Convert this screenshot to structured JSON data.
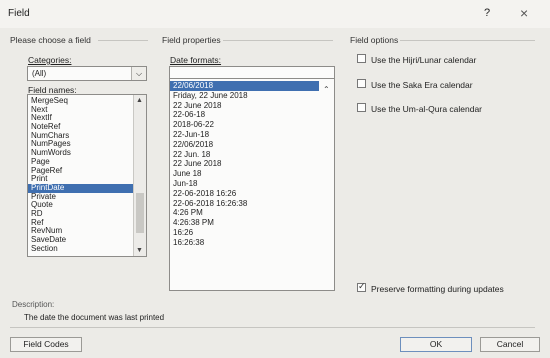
{
  "window": {
    "title": "Field",
    "help": "?",
    "close": "×"
  },
  "left": {
    "group": "Please choose a field",
    "categories_label": "Categories:",
    "categories_value": "(All)",
    "fieldnames_label": "Field names:",
    "fields": [
      "MergeSeq",
      "Next",
      "NextIf",
      "NoteRef",
      "NumChars",
      "NumPages",
      "NumWords",
      "Page",
      "PageRef",
      "Print",
      "PrintDate",
      "Private",
      "Quote",
      "RD",
      "Ref",
      "RevNum",
      "SaveDate",
      "Section"
    ],
    "selected_field": "PrintDate"
  },
  "middle": {
    "group": "Field properties",
    "formats_label": "Date formats:",
    "formats": [
      "22/06/2018",
      "Friday, 22 June 2018",
      "22 June 2018",
      "22-06-18",
      "2018-06-22",
      "22-Jun-18",
      "22/06/2018",
      "22 Jun. 18",
      "22 June 2018",
      "June 18",
      "Jun-18",
      "22-06-2018 16:26",
      "22-06-2018 16:26:38",
      "4:26 PM",
      "4:26:38 PM",
      "16:26",
      "16:26:38"
    ]
  },
  "right": {
    "group": "Field options",
    "options": [
      {
        "label": "Use the Hijri/Lunar calendar",
        "checked": false
      },
      {
        "label": "Use the Saka Era calendar",
        "checked": false
      },
      {
        "label": "Use the Um-al-Qura calendar",
        "checked": false
      }
    ],
    "preserve_label": "Preserve formatting during updates",
    "preserve_checked": true
  },
  "description": {
    "label": "Description:",
    "text": "The date the document was last printed"
  },
  "buttons": {
    "field_codes": "Field Codes",
    "ok": "OK",
    "cancel": "Cancel"
  }
}
